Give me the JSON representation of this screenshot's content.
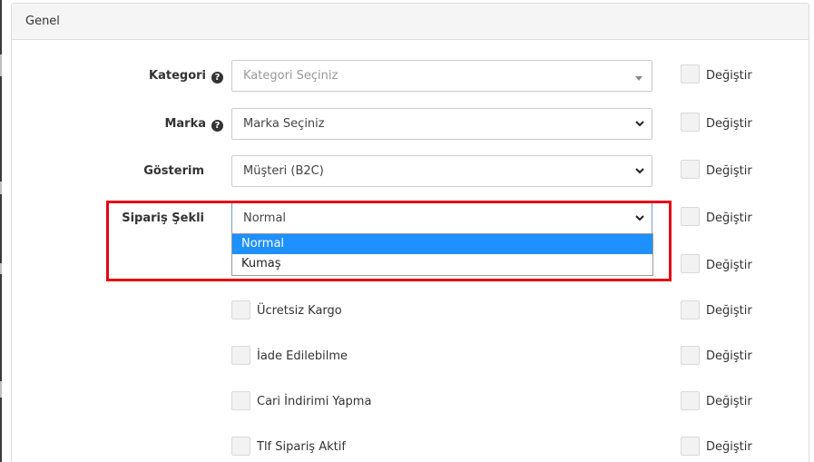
{
  "panel": {
    "title": "Genel"
  },
  "fields": {
    "kategori": {
      "label": "Kategori",
      "value": "Kategori Seçiniz"
    },
    "marka": {
      "label": "Marka",
      "value": "Marka Seçiniz"
    },
    "gosterim": {
      "label": "Gösterim",
      "value": "Müşteri (B2C)"
    },
    "siparis": {
      "label": "Sipariş Şekli",
      "value": "Normal",
      "options": [
        "Normal",
        "Kumaş"
      ]
    }
  },
  "checkboxes": [
    {
      "label": "Ücretsiz Kargo"
    },
    {
      "label": "İade Edilebilme"
    },
    {
      "label": "Cari İndirimi Yapma"
    },
    {
      "label": "Tlf Sipariş Aktif"
    }
  ],
  "change_label": "Değiştir",
  "help_icon": "question-circle",
  "colors": {
    "highlight": "#e20613",
    "dropdown_selected": "#1e90ff"
  }
}
